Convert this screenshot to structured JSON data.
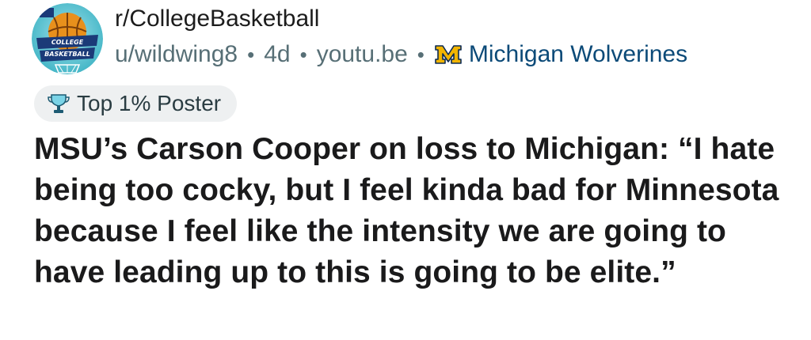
{
  "post": {
    "subreddit": "r/CollegeBasketball",
    "author": "u/wildwing8",
    "age": "4d",
    "domain": "youtu.be",
    "separator": "•",
    "team_flair": {
      "logo_letter": "M",
      "label": "Michigan Wolverines",
      "logo_colors": {
        "fill": "#f2b400",
        "stroke": "#0b2a55"
      }
    },
    "badge": {
      "icon": "trophy-icon",
      "label": "Top 1% Poster"
    },
    "avatar": {
      "icon": "college-basketball-logo",
      "lines": [
        "COLLEGE",
        "BASKETBALL"
      ]
    },
    "title": "MSU’s Carson Cooper on loss to Michigan: “I hate being too cocky, but I feel kinda bad for Minnesota because I feel like the intensity we are going to have leading up to this is going to be elite.”"
  }
}
